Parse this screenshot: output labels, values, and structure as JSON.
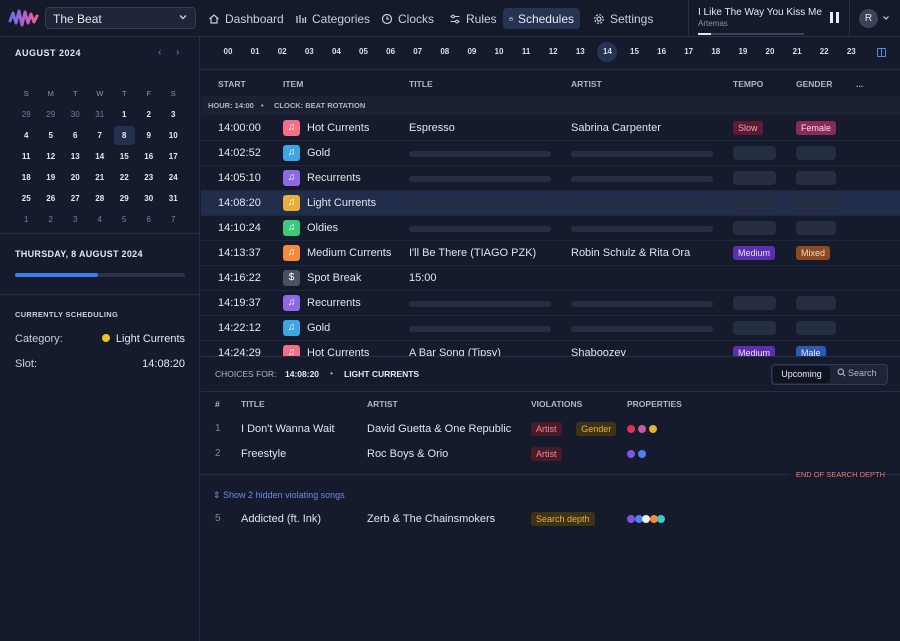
{
  "header": {
    "station": "The Beat",
    "nav": [
      {
        "label": "Dashboard",
        "icon": "home-icon"
      },
      {
        "label": "Categories",
        "icon": "bars-icon"
      },
      {
        "label": "Clocks",
        "icon": "clock-icon"
      },
      {
        "label": "Rules",
        "icon": "sliders-icon"
      },
      {
        "label": "Schedules",
        "icon": "calendar-icon",
        "active": true
      },
      {
        "label": "Settings",
        "icon": "gear-icon"
      }
    ],
    "now_playing": {
      "title": "I Like The Way You Kiss Me",
      "artist": "Artemas",
      "progress": 0.12
    },
    "avatar": "R"
  },
  "calendar": {
    "month": "AUGUST 2024",
    "prev": "‹",
    "next": "›",
    "weekdays": [
      "S",
      "M",
      "T",
      "W",
      "T",
      "F",
      "S"
    ],
    "weeks": [
      [
        "28",
        "29",
        "30",
        "31",
        "1",
        "2",
        "3"
      ],
      [
        "4",
        "5",
        "6",
        "7",
        "8",
        "9",
        "10"
      ],
      [
        "11",
        "12",
        "13",
        "14",
        "15",
        "16",
        "17"
      ],
      [
        "18",
        "19",
        "20",
        "21",
        "22",
        "23",
        "24"
      ],
      [
        "25",
        "26",
        "27",
        "28",
        "29",
        "30",
        "31"
      ],
      [
        "1",
        "2",
        "3",
        "4",
        "5",
        "6",
        "7"
      ]
    ],
    "selected": "8"
  },
  "day": {
    "label": "THURSDAY, 8 AUGUST 2024",
    "progress": 0.49
  },
  "current": {
    "heading": "CURRENTLY SCHEDULING",
    "category_label": "Category:",
    "category_value": "Light Currents",
    "category_color": "#f0c419",
    "slot_label": "Slot:",
    "slot_value": "14:08:20"
  },
  "hours": [
    "00",
    "01",
    "02",
    "03",
    "04",
    "05",
    "06",
    "07",
    "08",
    "09",
    "10",
    "11",
    "12",
    "13",
    "14",
    "15",
    "16",
    "17",
    "18",
    "19",
    "20",
    "21",
    "22",
    "23"
  ],
  "active_hour": "14",
  "schedule": {
    "columns": {
      "start": "START",
      "item": "ITEM",
      "title": "TITLE",
      "artist": "ARTIST",
      "tempo": "TEMPO",
      "gender": "GENDER",
      "more": "..."
    },
    "hour_label": "HOUR: 14:00",
    "clock_label": "CLOCK: BEAT ROTATION",
    "rows": [
      {
        "time": "14:00:00",
        "category": "Hot Currents",
        "icon": "music-icon",
        "color": "hot",
        "title": "Espresso",
        "artist": "Sabrina Carpenter",
        "tempo": "Slow",
        "tempo_cls": "slow",
        "gender": "Female",
        "gender_cls": "female"
      },
      {
        "time": "14:02:52",
        "category": "Gold",
        "icon": "music-icon",
        "color": "gold"
      },
      {
        "time": "14:05:10",
        "category": "Recurrents",
        "icon": "music-icon",
        "color": "rec"
      },
      {
        "time": "14:08:20",
        "category": "Light Currents",
        "icon": "music-icon",
        "color": "light",
        "selected": true
      },
      {
        "time": "14:10:24",
        "category": "Oldies",
        "icon": "music-icon",
        "color": "old"
      },
      {
        "time": "14:13:37",
        "category": "Medium Currents",
        "icon": "music-icon",
        "color": "med",
        "title": "I'll Be There (TIAGO PZK)",
        "artist": "Robin Schulz & Rita Ora",
        "tempo": "Medium",
        "tempo_cls": "medium",
        "gender": "Mixed",
        "gender_cls": "mixed"
      },
      {
        "time": "14:16:22",
        "category": "Spot Break",
        "icon": "dollar-icon",
        "color": "spot",
        "title": "15:00",
        "spot": true
      },
      {
        "time": "14:19:37",
        "category": "Recurrents",
        "icon": "music-icon",
        "color": "rec"
      },
      {
        "time": "14:22:12",
        "category": "Gold",
        "icon": "music-icon",
        "color": "gold"
      },
      {
        "time": "14:24:29",
        "category": "Hot Currents",
        "icon": "music-icon",
        "color": "hot",
        "title": "A Bar Song (Tipsy)",
        "artist": "Shaboozey",
        "tempo": "Medium",
        "tempo_cls": "medium",
        "gender": "Male",
        "gender_cls": "male"
      }
    ]
  },
  "choices": {
    "label": "CHOICES FOR:",
    "time": "14:08:20",
    "sep": "•",
    "category": "LIGHT CURRENTS",
    "tab_upcoming": "Upcoming",
    "tab_search": "Search",
    "columns": {
      "num": "#",
      "title": "TITLE",
      "artist": "ARTIST",
      "violations": "VIOLATIONS",
      "properties": "PROPERTIES"
    },
    "rows": [
      {
        "num": "1",
        "title": "I Don't Wanna Wait",
        "artist": "David Guetta & One Republic",
        "violations": [
          {
            "label": "Artist",
            "cls": "artist"
          },
          {
            "label": "Gender",
            "cls": "gender"
          }
        ],
        "dots": [
          "#e0344f",
          "#c85aa0",
          "#e6b13a"
        ]
      },
      {
        "num": "2",
        "title": "Freestyle",
        "artist": "Roc Boys & Orio",
        "violations": [
          {
            "label": "Artist",
            "cls": "artist"
          }
        ],
        "dots": [
          "#7a55e6",
          "#4a82f0"
        ]
      }
    ],
    "end_label": "END OF SEARCH DEPTH",
    "hidden_link": "Show 2 hidden violating songs",
    "row5": {
      "num": "5",
      "title": "Addicted (ft. Ink)",
      "artist": "Zerb & The Chainsmokers",
      "violations": [
        {
          "label": "Search depth",
          "cls": "depth"
        }
      ],
      "dots": [
        "#7a55e6",
        "#4a82f0",
        "#f0f0f0",
        "#f28b3a",
        "#3bc9c9"
      ]
    }
  }
}
